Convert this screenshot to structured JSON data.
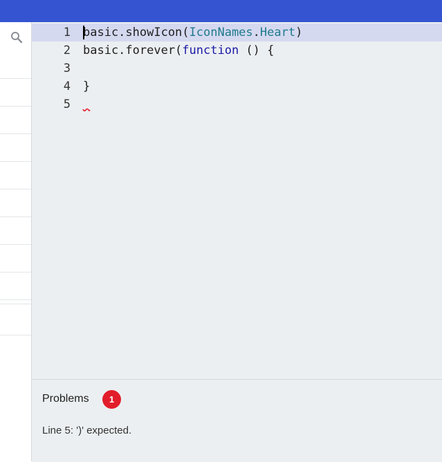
{
  "colors": {
    "topbar": "#3454d1",
    "editor_background": "#eceff1",
    "active_line_highlight": "#d5d9f0",
    "keyword": "#1a1aa6",
    "parameter": "#1f7a8c",
    "error_badge": "#e21d2b",
    "error_squiggle": "#e21d2b"
  },
  "sidebar": {
    "search_icon": "search-icon"
  },
  "editor": {
    "active_line": 1,
    "lines": [
      {
        "number": "1",
        "tokens": [
          {
            "text": "basic.showIcon(",
            "kind": "plain"
          },
          {
            "text": "IconNames",
            "kind": "param"
          },
          {
            "text": ".",
            "kind": "plain"
          },
          {
            "text": "Heart",
            "kind": "param"
          },
          {
            "text": ")",
            "kind": "plain"
          }
        ]
      },
      {
        "number": "2",
        "tokens": [
          {
            "text": "basic.forever(",
            "kind": "plain"
          },
          {
            "text": "function",
            "kind": "kw"
          },
          {
            "text": " () {",
            "kind": "plain"
          }
        ]
      },
      {
        "number": "3",
        "tokens": []
      },
      {
        "number": "4",
        "tokens": [
          {
            "text": "}",
            "kind": "plain"
          }
        ]
      },
      {
        "number": "5",
        "tokens": []
      }
    ]
  },
  "problems": {
    "title": "Problems",
    "count": "1",
    "items": [
      "Line 5: ')' expected."
    ]
  }
}
